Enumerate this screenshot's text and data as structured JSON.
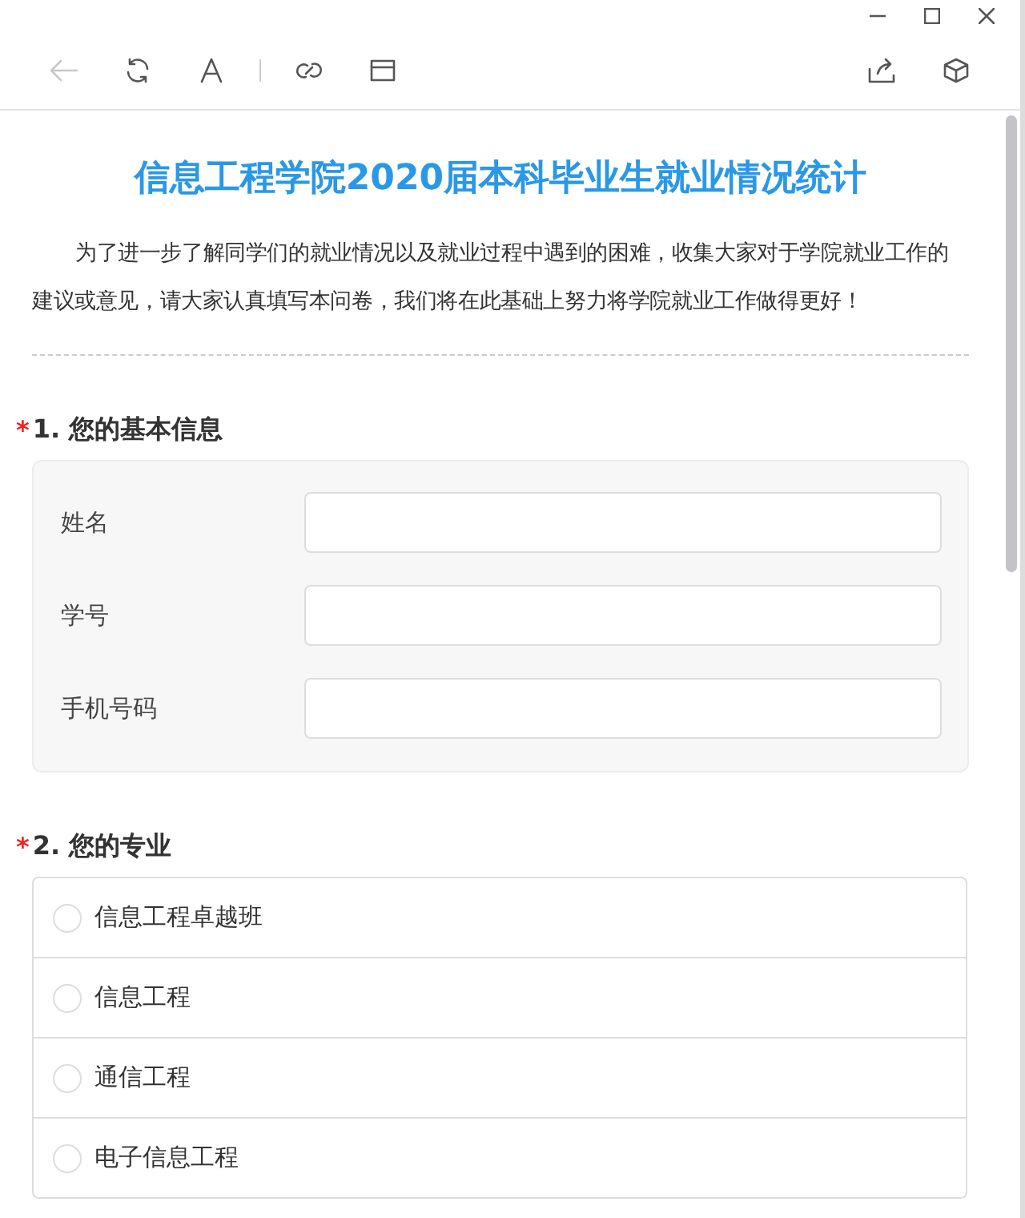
{
  "toolbar": {
    "left": [
      {
        "kind": "back",
        "disabled": true
      },
      {
        "kind": "refresh",
        "disabled": false
      },
      {
        "kind": "font",
        "disabled": false
      },
      {
        "kind": "separator",
        "disabled": false
      },
      {
        "kind": "link",
        "disabled": false
      },
      {
        "kind": "window",
        "disabled": false
      }
    ],
    "right": [
      {
        "kind": "share",
        "disabled": false
      },
      {
        "kind": "cube",
        "disabled": false
      }
    ]
  },
  "survey": {
    "title": "信息工程学院2020届本科毕业生就业情况统计",
    "intro": "为了进一步了解同学们的就业情况以及就业过程中遇到的困难，收集大家对于学院就业工作的建议或意见，请大家认真填写本问卷，我们将在此基础上努力将学院就业工作做得更好！",
    "questions": [
      {
        "kind": "fields",
        "marker": "*",
        "title": "1. 您的基本信息",
        "fields": [
          {
            "label": "姓名"
          },
          {
            "label": "学号"
          },
          {
            "label": "手机号码"
          }
        ]
      },
      {
        "kind": "radio",
        "marker": "*",
        "title": "2. 您的专业",
        "options": [
          {
            "label": "信息工程卓越班",
            "selected": false
          },
          {
            "label": "信息工程",
            "selected": false
          },
          {
            "label": "通信工程",
            "selected": false
          },
          {
            "label": "电子信息工程",
            "selected": false
          }
        ]
      }
    ]
  }
}
